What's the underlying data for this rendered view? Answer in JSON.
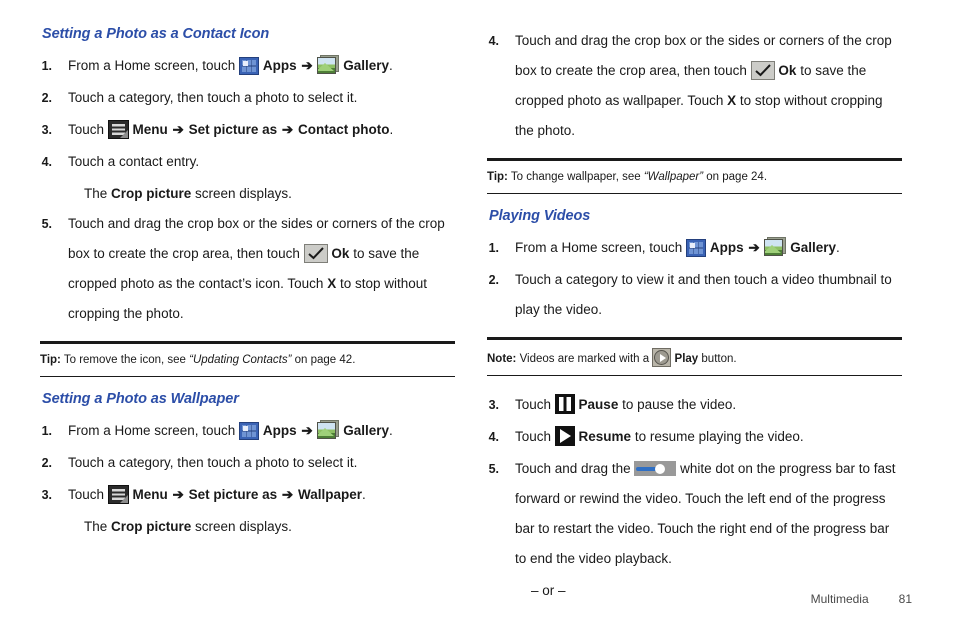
{
  "document": {
    "footer": {
      "chapter": "Multimedia",
      "page_number": "81"
    }
  },
  "icons": {
    "apps": "apps-grid-icon",
    "gallery": "gallery-photo-icon",
    "menu": "menu-icon",
    "ok": "checkmark-ok-icon",
    "play": "play-circle-icon",
    "pause": "pause-icon",
    "resume": "resume-play-icon",
    "slider": "progress-bar-slider-icon"
  },
  "colors": {
    "heading": "#2c4ea8",
    "body_text": "#1a1a1a",
    "apps_icon_blue": "#3a63b5",
    "slider_fill_blue": "#2f6fc4"
  },
  "left_column": {
    "section1": {
      "heading": "Setting a Photo as a Contact Icon",
      "steps": [
        {
          "num": "1.",
          "parts": [
            {
              "type": "text",
              "text": "From a Home screen, touch "
            },
            {
              "type": "icon",
              "icon": "apps"
            },
            {
              "type": "bold",
              "text": "Apps"
            },
            {
              "type": "arrow",
              "text": "➔"
            },
            {
              "type": "icon",
              "icon": "gallery"
            },
            {
              "type": "bold",
              "text": "Gallery"
            },
            {
              "type": "text",
              "text": "."
            }
          ]
        },
        {
          "num": "2.",
          "parts": [
            {
              "type": "text",
              "text": "Touch a category, then touch a photo to select it."
            }
          ]
        },
        {
          "num": "3.",
          "parts": [
            {
              "type": "text",
              "text": "Touch "
            },
            {
              "type": "icon",
              "icon": "menu"
            },
            {
              "type": "bold",
              "text": "Menu"
            },
            {
              "type": "arrow",
              "text": "➔"
            },
            {
              "type": "bold",
              "text": "Set picture as"
            },
            {
              "type": "arrow",
              "text": "➔"
            },
            {
              "type": "bold",
              "text": "Contact photo"
            },
            {
              "type": "text",
              "text": "."
            }
          ]
        },
        {
          "num": "4.",
          "parts": [
            {
              "type": "text",
              "text": "Touch a contact entry."
            }
          ],
          "sub": [
            {
              "type": "text",
              "text": "The "
            },
            {
              "type": "bold",
              "text": "Crop picture"
            },
            {
              "type": "text",
              "text": " screen displays."
            }
          ]
        },
        {
          "num": "5.",
          "parts": [
            {
              "type": "text",
              "text": "Touch and drag the crop box or the sides or corners of the crop box to create the crop area, then touch "
            },
            {
              "type": "icon",
              "icon": "ok"
            },
            {
              "type": "bold",
              "text": "Ok"
            },
            {
              "type": "text",
              "text": " to save the cropped photo as the contact’s icon. Touch "
            },
            {
              "type": "bold",
              "text": "X"
            },
            {
              "type": "text",
              "text": " to stop without cropping the photo."
            }
          ]
        }
      ],
      "callout": {
        "lead": "Tip:",
        "text_before": " To remove the icon, see ",
        "reference": "“Updating Contacts”",
        "text_after": " on page 42."
      }
    },
    "section2": {
      "heading": "Setting a Photo as Wallpaper",
      "steps": [
        {
          "num": "1.",
          "parts": [
            {
              "type": "text",
              "text": "From a Home screen, touch "
            },
            {
              "type": "icon",
              "icon": "apps"
            },
            {
              "type": "bold",
              "text": "Apps"
            },
            {
              "type": "arrow",
              "text": "➔"
            },
            {
              "type": "icon",
              "icon": "gallery"
            },
            {
              "type": "bold",
              "text": "Gallery"
            },
            {
              "type": "text",
              "text": "."
            }
          ]
        },
        {
          "num": "2.",
          "parts": [
            {
              "type": "text",
              "text": "Touch a category, then touch a photo to select it."
            }
          ]
        },
        {
          "num": "3.",
          "parts": [
            {
              "type": "text",
              "text": "Touch "
            },
            {
              "type": "icon",
              "icon": "menu"
            },
            {
              "type": "bold",
              "text": "Menu"
            },
            {
              "type": "arrow",
              "text": "➔"
            },
            {
              "type": "bold",
              "text": "Set picture as"
            },
            {
              "type": "arrow",
              "text": "➔"
            },
            {
              "type": "bold",
              "text": "Wallpaper"
            },
            {
              "type": "text",
              "text": "."
            }
          ],
          "sub": [
            {
              "type": "text",
              "text": "The "
            },
            {
              "type": "bold",
              "text": "Crop picture"
            },
            {
              "type": "text",
              "text": " screen displays."
            }
          ]
        }
      ]
    }
  },
  "right_column": {
    "section3_continued": {
      "steps": [
        {
          "num": "4.",
          "parts": [
            {
              "type": "text",
              "text": "Touch and drag the crop box or the sides or corners of the crop box to create the crop area, then touch "
            },
            {
              "type": "icon",
              "icon": "ok"
            },
            {
              "type": "bold",
              "text": "Ok"
            },
            {
              "type": "text",
              "text": " to save the cropped photo as wallpaper. Touch "
            },
            {
              "type": "bold",
              "text": "X"
            },
            {
              "type": "text",
              "text": " to stop without cropping the photo."
            }
          ]
        }
      ],
      "callout": {
        "lead": "Tip:",
        "text_before": " To change wallpaper, see ",
        "reference": "“Wallpaper”",
        "text_after": " on page 24."
      }
    },
    "section4": {
      "heading": "Playing Videos",
      "steps_before_note": [
        {
          "num": "1.",
          "parts": [
            {
              "type": "text",
              "text": "From a Home screen, touch "
            },
            {
              "type": "icon",
              "icon": "apps"
            },
            {
              "type": "bold",
              "text": "Apps"
            },
            {
              "type": "arrow",
              "text": "➔"
            },
            {
              "type": "icon",
              "icon": "gallery"
            },
            {
              "type": "bold",
              "text": "Gallery"
            },
            {
              "type": "text",
              "text": "."
            }
          ]
        },
        {
          "num": "2.",
          "parts": [
            {
              "type": "text",
              "text": "Touch a category to view it and then touch a video thumbnail to play the video."
            }
          ]
        }
      ],
      "callout": {
        "lead": "Note:",
        "text_before": " Videos are marked with a ",
        "icon": "play",
        "bold": "Play",
        "text_after": " button."
      },
      "steps_after_note": [
        {
          "num": "3.",
          "parts": [
            {
              "type": "text",
              "text": "Touch "
            },
            {
              "type": "icon",
              "icon": "pause"
            },
            {
              "type": "bold",
              "text": "Pause"
            },
            {
              "type": "text",
              "text": " to pause the video."
            }
          ]
        },
        {
          "num": "4.",
          "parts": [
            {
              "type": "text",
              "text": "Touch "
            },
            {
              "type": "icon",
              "icon": "resume"
            },
            {
              "type": "bold",
              "text": "Resume"
            },
            {
              "type": "text",
              "text": " to resume playing the video."
            }
          ]
        },
        {
          "num": "5.",
          "parts": [
            {
              "type": "text",
              "text": "Touch and drag the "
            },
            {
              "type": "icon",
              "icon": "slider"
            },
            {
              "type": "text",
              "text": " white dot on the progress bar to fast forward or rewind the video. Touch the left end of the progress bar to restart the video. Touch the right end of the progress bar to end the video playback."
            }
          ],
          "or": "– or –"
        }
      ]
    }
  }
}
